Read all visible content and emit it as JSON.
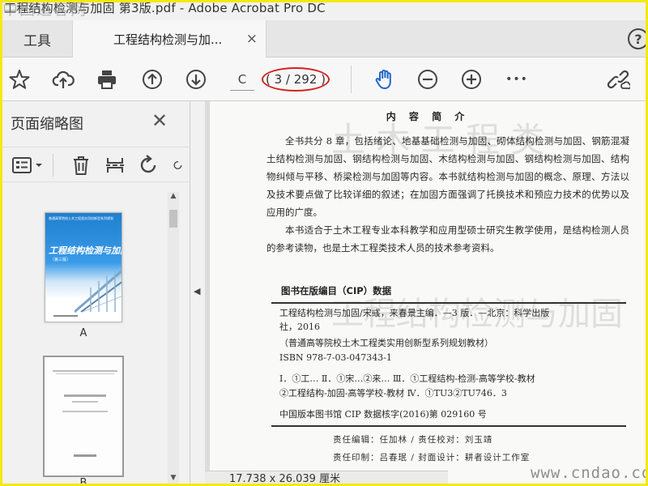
{
  "window": {
    "title": "工程结构检测与加固 第3版.pdf - Adobe Acrobat Pro DC",
    "watermark": "中国道客网"
  },
  "tabs": {
    "tools_label": "工具",
    "doc_label": "工程结构检测与加...",
    "close_glyph": "×",
    "help_glyph": "?"
  },
  "toolbar": {
    "page_input": "C",
    "page_count": "( 3 / 292 )",
    "more_glyph": "•••"
  },
  "thumbnail_pane": {
    "title": "页面缩略图",
    "close_glyph": "✕",
    "thumbs": [
      {
        "label": "A",
        "cover_title": "工程结构检测与加固",
        "cover_edition": "（第三版）",
        "cover_series": "普通高等院校土木工程类实用创新型系列规划教材"
      },
      {
        "label": "B"
      }
    ]
  },
  "document": {
    "heading": "内 容 简 介",
    "para1": "全书共分 8 章，包括绪论、地基基础检测与加固、砌体结构检测与加固、钢筋混凝土结构检测与加固、钢结构检测与加固、木结构检测与加固、钢结构检测与加固、结构物纠倾与平移、桥梁检测与加固等内容。本书就结构检测与加固的概念、原理、方法以及技术要点做了比较详细的叙述；在加固方面强调了托换技术和预应力技术的优势以及应用的广度。",
    "para2": "本书适合于土木工程专业本科教学和应用型硕士研究生教学使用，是结构检测人员的参考读物，也是土木工程类技术人员的技术参考资料。",
    "cip_title": "图书在版编目（CIP）数据",
    "cip_lines": [
      "工程结构检测与加固/宋彧，来春景主编．—3 版．—北京：科学出版",
      "社，2016",
      "（普通高等院校土木工程类实用创新型系列规划教材）",
      "ISBN 978-7-03-047343-1",
      "Ⅰ．①工…   Ⅱ．①宋…②来…   Ⅲ．①工程结构-检测-高等学校-教材",
      "②工程结构-加固-高等学校-教材   Ⅳ．①TU3②TU746．3",
      "中国版本图书馆 CIP 数据核字(2016)第 029160 号"
    ],
    "staff_line1": "责任编辑：任加林 / 责任校对：刘玉靖",
    "staff_line2": "责任印制：吕春珉 / 封面设计：耕者设计工作室",
    "page_watermark": "www.cndao.com"
  },
  "status": {
    "page_size": "17.738 x 26.039 厘米"
  },
  "colors": {
    "outer_border": "#f5e90f",
    "hand_tool_active": "#2266cc",
    "page_count_circle": "#d62020"
  }
}
